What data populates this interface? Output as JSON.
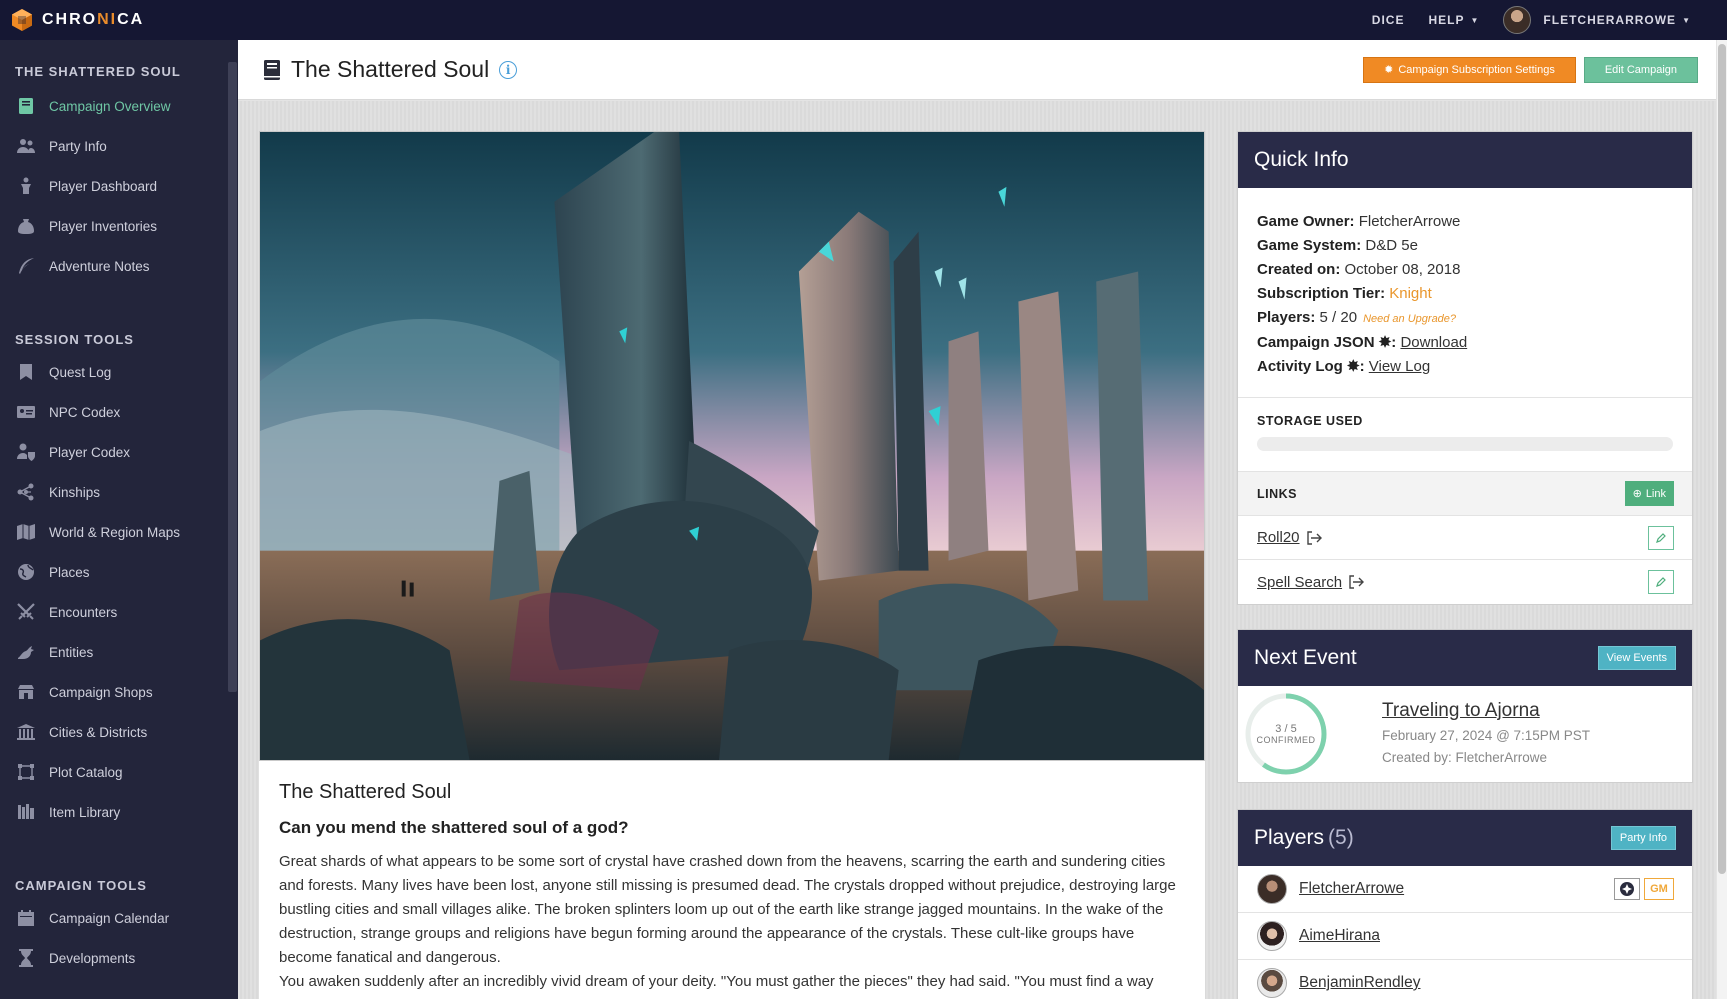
{
  "app": {
    "brand_a": "CHRO",
    "brand_b": "NI",
    "brand_c": "CA"
  },
  "topnav": {
    "dice": "DICE",
    "help": "HELP",
    "user": "FLETCHERARROWE"
  },
  "sidebar": {
    "section1": "THE SHATTERED SOUL",
    "items1": [
      {
        "label": "Campaign Overview",
        "icon": "book-icon"
      },
      {
        "label": "Party Info",
        "icon": "party-icon"
      },
      {
        "label": "Player Dashboard",
        "icon": "dashboard-icon"
      },
      {
        "label": "Player Inventories",
        "icon": "bag-icon"
      },
      {
        "label": "Adventure Notes",
        "icon": "quill-icon"
      }
    ],
    "section2": "SESSION TOOLS",
    "items2": [
      {
        "label": "Quest Log",
        "icon": "bookmark-icon"
      },
      {
        "label": "NPC Codex",
        "icon": "id-card-icon"
      },
      {
        "label": "Player Codex",
        "icon": "player-shield-icon"
      },
      {
        "label": "Kinships",
        "icon": "network-icon"
      },
      {
        "label": "World & Region Maps",
        "icon": "map-icon"
      },
      {
        "label": "Places",
        "icon": "globe-icon"
      },
      {
        "label": "Encounters",
        "icon": "crossed-swords-icon"
      },
      {
        "label": "Entities",
        "icon": "dragon-icon"
      },
      {
        "label": "Campaign Shops",
        "icon": "shop-icon"
      },
      {
        "label": "Cities & Districts",
        "icon": "building-icon"
      },
      {
        "label": "Plot Catalog",
        "icon": "plot-icon"
      },
      {
        "label": "Item Library",
        "icon": "library-icon"
      }
    ],
    "section3": "CAMPAIGN TOOLS",
    "items3": [
      {
        "label": "Campaign Calendar",
        "icon": "calendar-icon"
      },
      {
        "label": "Developments",
        "icon": "hourglass-icon"
      }
    ]
  },
  "header": {
    "title": "The Shattered Soul",
    "subscription_btn": "Campaign Subscription Settings",
    "edit_btn": "Edit Campaign"
  },
  "description": {
    "title": "The Shattered Soul",
    "subtitle": "Can you mend the shattered soul of a god?",
    "para1": "Great shards of what appears to be some sort of crystal have crashed down from the heavens, scarring the earth and sundering cities and forests. Many lives have been lost, anyone still missing is presumed dead. The crystals dropped without prejudice, destroying large bustling cities and small villages alike. The broken splinters loom up out of the earth like strange jagged mountains. In the wake of the destruction, strange groups and religions have begun forming around the appearance of the crystals. These cult-like groups have become fanatical and dangerous.",
    "para2": "You awaken suddenly after an incredibly vivid dream of your deity. \"You must gather the pieces\" they had said. \"You must find a way"
  },
  "quick_info": {
    "title": "Quick Info",
    "owner_label": "Game Owner:",
    "owner": "FletcherArrowe",
    "system_label": "Game System:",
    "system": "D&D 5e",
    "created_label": "Created on:",
    "created": "October 08, 2018",
    "tier_label": "Subscription Tier:",
    "tier": "Knight",
    "players_label": "Players:",
    "players": "5 / 20",
    "upgrade": "Need an Upgrade?",
    "json_label": "Campaign JSON",
    "json_link": "Download",
    "log_label": "Activity Log",
    "log_link": "View Log",
    "storage_label": "STORAGE USED",
    "links_label": "LINKS",
    "link_btn": "Link",
    "links": [
      {
        "name": "Roll20"
      },
      {
        "name": "Spell Search"
      }
    ]
  },
  "next_event": {
    "title": "Next Event",
    "view_btn": "View Events",
    "confirmed": "3 / 5",
    "confirmed_label": "CONFIRMED",
    "confirmed_fraction": 0.6,
    "event_title": "Traveling to Ajorna",
    "date": "February 27, 2024 @ 7:15PM PST",
    "created_by": "Created by: FletcherArrowe"
  },
  "players": {
    "title": "Players",
    "count": "(5)",
    "party_btn": "Party Info",
    "list": [
      {
        "name": "FletcherArrowe",
        "gm": "GM"
      },
      {
        "name": "AimeHirana"
      },
      {
        "name": "BenjaminRendley"
      }
    ]
  },
  "colors": {
    "accent_green": "#6fc7a5",
    "orange": "#f08a24",
    "navy": "#151733"
  }
}
